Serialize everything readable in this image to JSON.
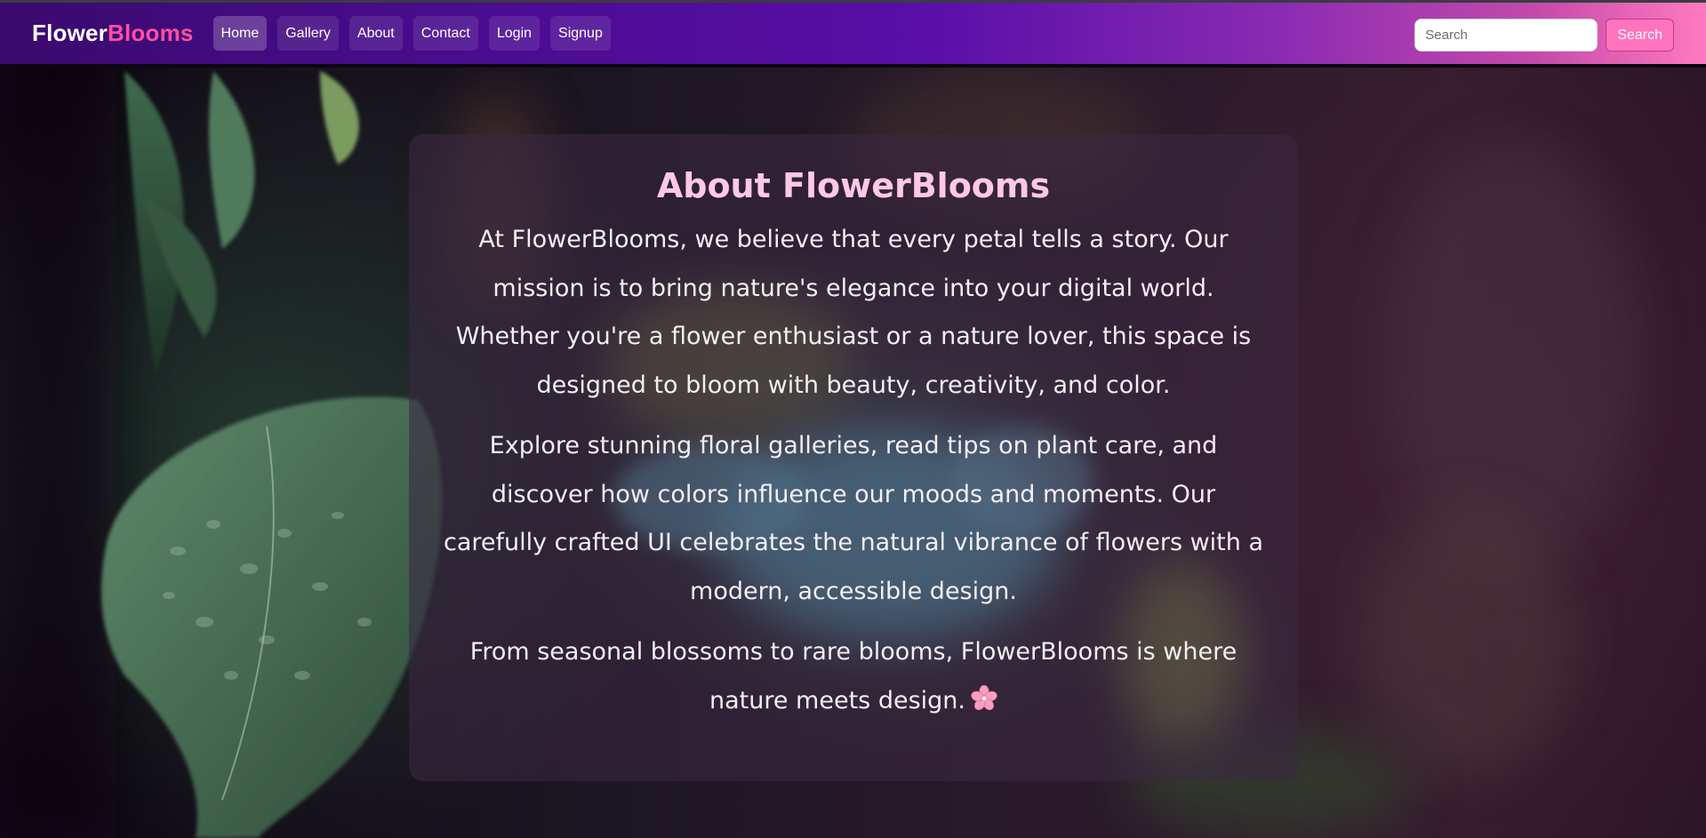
{
  "navbar": {
    "brand_primary": "Flower",
    "brand_accent": "Blooms",
    "links": [
      {
        "label": "Home",
        "active": true
      },
      {
        "label": "Gallery",
        "active": false
      },
      {
        "label": "About",
        "active": false
      },
      {
        "label": "Contact",
        "active": false
      },
      {
        "label": "Login",
        "active": false
      },
      {
        "label": "Signup",
        "active": false
      }
    ],
    "search": {
      "placeholder": "Search",
      "value": "",
      "button_label": "Search"
    }
  },
  "about": {
    "title": "About FlowerBlooms",
    "paragraphs": [
      "At FlowerBlooms, we believe that every petal tells a story. Our mission is to bring nature's elegance into your digital world. Whether you're a flower enthusiast or a nature lover, this space is designed to bloom with beauty, creativity, and color.",
      "Explore stunning floral galleries, read tips on plant care, and discover how colors influence our moods and moments. Our carefully crafted UI celebrates the natural vibrance of flowers with a modern, accessible design.",
      "From seasonal blossoms to rare blooms, FlowerBlooms is where nature meets design."
    ],
    "emoji_icon": "cherry-blossom-icon"
  },
  "colors": {
    "navbar_gradient_start": "#3a0a6e",
    "navbar_gradient_end": "#ff7ac0",
    "brand_accent": "#ff4fa0",
    "title_pink": "#ffc8e6",
    "search_button": "#ff74bd"
  }
}
